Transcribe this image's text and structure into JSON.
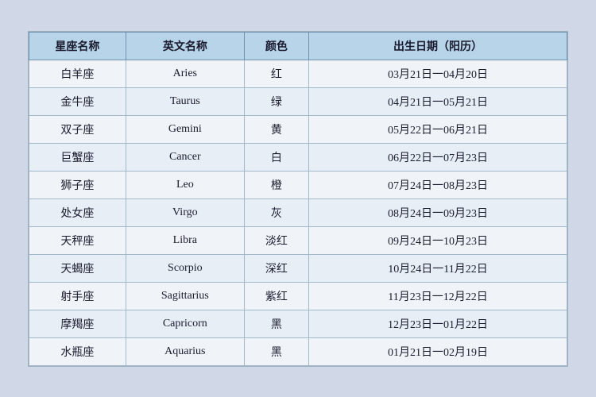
{
  "table": {
    "headers": {
      "zh_name": "星座名称",
      "en_name": "英文名称",
      "color": "颜色",
      "date": "出生日期（阳历）"
    },
    "rows": [
      {
        "zh": "白羊座",
        "en": "Aries",
        "color": "红",
        "date": "03月21日一04月20日"
      },
      {
        "zh": "金牛座",
        "en": "Taurus",
        "color": "绿",
        "date": "04月21日一05月21日"
      },
      {
        "zh": "双子座",
        "en": "Gemini",
        "color": "黄",
        "date": "05月22日一06月21日"
      },
      {
        "zh": "巨蟹座",
        "en": "Cancer",
        "color": "白",
        "date": "06月22日一07月23日"
      },
      {
        "zh": "狮子座",
        "en": "Leo",
        "color": "橙",
        "date": "07月24日一08月23日"
      },
      {
        "zh": "处女座",
        "en": "Virgo",
        "color": "灰",
        "date": "08月24日一09月23日"
      },
      {
        "zh": "天秤座",
        "en": "Libra",
        "color": "淡红",
        "date": "09月24日一10月23日"
      },
      {
        "zh": "天蝎座",
        "en": "Scorpio",
        "color": "深红",
        "date": "10月24日一11月22日"
      },
      {
        "zh": "射手座",
        "en": "Sagittarius",
        "color": "紫红",
        "date": "11月23日一12月22日"
      },
      {
        "zh": "摩羯座",
        "en": "Capricorn",
        "color": "黑",
        "date": "12月23日一01月22日"
      },
      {
        "zh": "水瓶座",
        "en": "Aquarius",
        "color": "黑",
        "date": "01月21日一02月19日"
      }
    ]
  }
}
